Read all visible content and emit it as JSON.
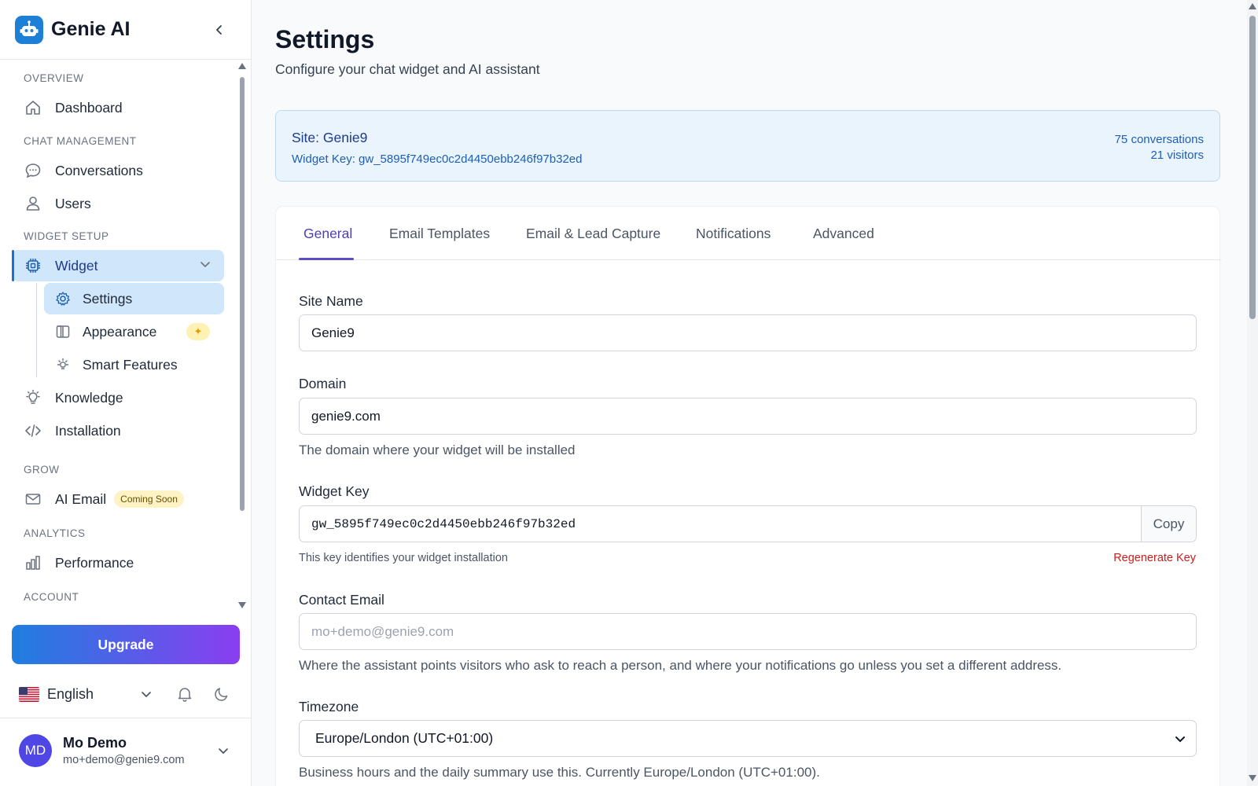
{
  "brand": {
    "name": "Genie AI",
    "logo_icon": "robot-icon"
  },
  "sidebar": {
    "sections": {
      "overview": "OVERVIEW",
      "chat_management": "CHAT MANAGEMENT",
      "widget_setup": "WIDGET SETUP",
      "grow": "GROW",
      "analytics": "ANALYTICS",
      "account": "ACCOUNT"
    },
    "items": {
      "dashboard": "Dashboard",
      "conversations": "Conversations",
      "users": "Users",
      "widget": "Widget",
      "settings": "Settings",
      "appearance": "Appearance",
      "smart_features": "Smart Features",
      "knowledge": "Knowledge",
      "installation": "Installation",
      "ai_email": "AI Email",
      "ai_email_badge": "Coming Soon",
      "performance": "Performance"
    },
    "appearance_badge_icon": "sparkle-icon",
    "upgrade_label": "Upgrade",
    "language": "English",
    "user": {
      "initials": "MD",
      "name": "Mo Demo",
      "email": "mo+demo@genie9.com"
    }
  },
  "header": {
    "title": "Settings",
    "subtitle": "Configure your chat widget and AI assistant"
  },
  "site_card": {
    "site_name": "Site: Genie9",
    "widget_key": "Widget Key: gw_5895f749ec0c2d4450ebb246f97b32ed",
    "conversations": "75 conversations",
    "visitors": "21 visitors"
  },
  "tabs": [
    "General",
    "Email Templates",
    "Email & Lead Capture",
    "Notifications",
    "Advanced"
  ],
  "active_tab": "General",
  "form": {
    "site_name_label": "Site Name",
    "site_name_value": "Genie9",
    "domain_label": "Domain",
    "domain_value": "genie9.com",
    "domain_help": "The domain where your widget will be installed",
    "widget_key_label": "Widget Key",
    "widget_key_value": "gw_5895f749ec0c2d4450ebb246f97b32ed",
    "copy_label": "Copy",
    "widget_key_help": "This key identifies your widget installation",
    "regenerate_label": "Regenerate Key",
    "contact_email_label": "Contact Email",
    "contact_email_placeholder": "mo+demo@genie9.com",
    "contact_email_help": "Where the assistant points visitors who ask to reach a person, and where your notifications go unless you set a different address.",
    "timezone_label": "Timezone",
    "timezone_value": "Europe/London (UTC+01:00)",
    "timezone_help": "Business hours and the daily summary use this. Currently Europe/London (UTC+01:00)."
  },
  "colors": {
    "accent": "#1d6fd1",
    "active_tab": "#4c3fb5",
    "danger": "#c81e1e",
    "upgrade_gradient_start": "#1f7ee0",
    "upgrade_gradient_end": "#8a3ef0"
  }
}
